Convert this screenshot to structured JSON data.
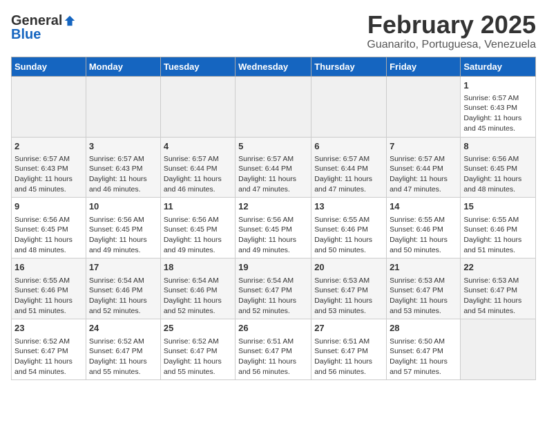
{
  "header": {
    "logo_general": "General",
    "logo_blue": "Blue",
    "month_title": "February 2025",
    "location": "Guanarito, Portuguesa, Venezuela"
  },
  "weekdays": [
    "Sunday",
    "Monday",
    "Tuesday",
    "Wednesday",
    "Thursday",
    "Friday",
    "Saturday"
  ],
  "weeks": [
    [
      {
        "day": "",
        "empty": true
      },
      {
        "day": "",
        "empty": true
      },
      {
        "day": "",
        "empty": true
      },
      {
        "day": "",
        "empty": true
      },
      {
        "day": "",
        "empty": true
      },
      {
        "day": "",
        "empty": true
      },
      {
        "day": "1",
        "sunrise": "6:57 AM",
        "sunset": "6:43 PM",
        "daylight": "11 hours and 45 minutes."
      }
    ],
    [
      {
        "day": "2",
        "sunrise": "6:57 AM",
        "sunset": "6:43 PM",
        "daylight": "11 hours and 45 minutes."
      },
      {
        "day": "3",
        "sunrise": "6:57 AM",
        "sunset": "6:43 PM",
        "daylight": "11 hours and 46 minutes."
      },
      {
        "day": "4",
        "sunrise": "6:57 AM",
        "sunset": "6:44 PM",
        "daylight": "11 hours and 46 minutes."
      },
      {
        "day": "5",
        "sunrise": "6:57 AM",
        "sunset": "6:44 PM",
        "daylight": "11 hours and 47 minutes."
      },
      {
        "day": "6",
        "sunrise": "6:57 AM",
        "sunset": "6:44 PM",
        "daylight": "11 hours and 47 minutes."
      },
      {
        "day": "7",
        "sunrise": "6:57 AM",
        "sunset": "6:44 PM",
        "daylight": "11 hours and 47 minutes."
      },
      {
        "day": "8",
        "sunrise": "6:56 AM",
        "sunset": "6:45 PM",
        "daylight": "11 hours and 48 minutes."
      }
    ],
    [
      {
        "day": "9",
        "sunrise": "6:56 AM",
        "sunset": "6:45 PM",
        "daylight": "11 hours and 48 minutes."
      },
      {
        "day": "10",
        "sunrise": "6:56 AM",
        "sunset": "6:45 PM",
        "daylight": "11 hours and 49 minutes."
      },
      {
        "day": "11",
        "sunrise": "6:56 AM",
        "sunset": "6:45 PM",
        "daylight": "11 hours and 49 minutes."
      },
      {
        "day": "12",
        "sunrise": "6:56 AM",
        "sunset": "6:45 PM",
        "daylight": "11 hours and 49 minutes."
      },
      {
        "day": "13",
        "sunrise": "6:55 AM",
        "sunset": "6:46 PM",
        "daylight": "11 hours and 50 minutes."
      },
      {
        "day": "14",
        "sunrise": "6:55 AM",
        "sunset": "6:46 PM",
        "daylight": "11 hours and 50 minutes."
      },
      {
        "day": "15",
        "sunrise": "6:55 AM",
        "sunset": "6:46 PM",
        "daylight": "11 hours and 51 minutes."
      }
    ],
    [
      {
        "day": "16",
        "sunrise": "6:55 AM",
        "sunset": "6:46 PM",
        "daylight": "11 hours and 51 minutes."
      },
      {
        "day": "17",
        "sunrise": "6:54 AM",
        "sunset": "6:46 PM",
        "daylight": "11 hours and 52 minutes."
      },
      {
        "day": "18",
        "sunrise": "6:54 AM",
        "sunset": "6:46 PM",
        "daylight": "11 hours and 52 minutes."
      },
      {
        "day": "19",
        "sunrise": "6:54 AM",
        "sunset": "6:47 PM",
        "daylight": "11 hours and 52 minutes."
      },
      {
        "day": "20",
        "sunrise": "6:53 AM",
        "sunset": "6:47 PM",
        "daylight": "11 hours and 53 minutes."
      },
      {
        "day": "21",
        "sunrise": "6:53 AM",
        "sunset": "6:47 PM",
        "daylight": "11 hours and 53 minutes."
      },
      {
        "day": "22",
        "sunrise": "6:53 AM",
        "sunset": "6:47 PM",
        "daylight": "11 hours and 54 minutes."
      }
    ],
    [
      {
        "day": "23",
        "sunrise": "6:52 AM",
        "sunset": "6:47 PM",
        "daylight": "11 hours and 54 minutes."
      },
      {
        "day": "24",
        "sunrise": "6:52 AM",
        "sunset": "6:47 PM",
        "daylight": "11 hours and 55 minutes."
      },
      {
        "day": "25",
        "sunrise": "6:52 AM",
        "sunset": "6:47 PM",
        "daylight": "11 hours and 55 minutes."
      },
      {
        "day": "26",
        "sunrise": "6:51 AM",
        "sunset": "6:47 PM",
        "daylight": "11 hours and 56 minutes."
      },
      {
        "day": "27",
        "sunrise": "6:51 AM",
        "sunset": "6:47 PM",
        "daylight": "11 hours and 56 minutes."
      },
      {
        "day": "28",
        "sunrise": "6:50 AM",
        "sunset": "6:47 PM",
        "daylight": "11 hours and 57 minutes."
      },
      {
        "day": "",
        "empty": true
      }
    ]
  ]
}
